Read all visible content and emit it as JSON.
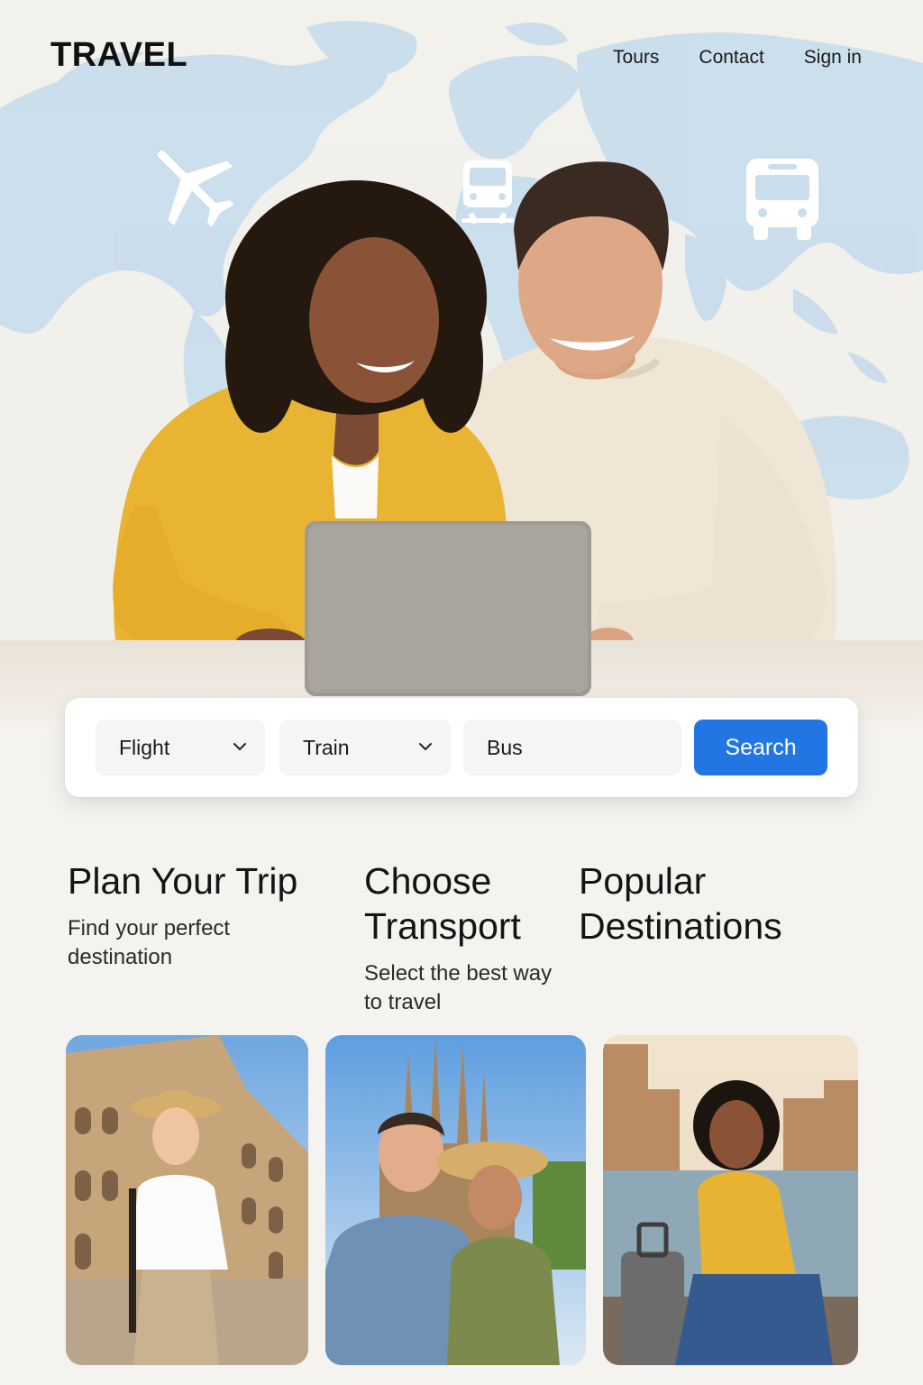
{
  "brand": {
    "logo": "TRAVEL"
  },
  "nav": {
    "items": [
      "Tours",
      "Contact",
      "Sign in"
    ]
  },
  "hero": {
    "icons": [
      "airplane-icon",
      "train-icon",
      "bus-icon"
    ]
  },
  "search": {
    "flight_label": "Flight",
    "train_label": "Train",
    "bus_placeholder": "Bus",
    "button_label": "Search"
  },
  "features": [
    {
      "title": "Plan Your Trip",
      "subtitle": "Find your perfect destination"
    },
    {
      "title": "Choose Transport",
      "subtitle": "Select the best way to travel"
    },
    {
      "title": "Popular Destinations",
      "subtitle": ""
    }
  ],
  "colors": {
    "accent": "#2176e3",
    "map": "#c6dcea",
    "background": "#f5f3ef"
  }
}
